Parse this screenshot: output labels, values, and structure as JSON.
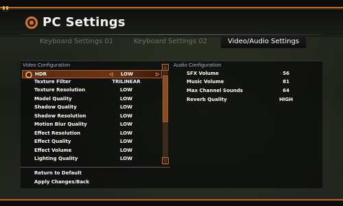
{
  "header": {
    "title": "PC Settings"
  },
  "tabs": [
    {
      "label": "Keyboard Settings 01",
      "active": false
    },
    {
      "label": "Keyboard Settings 02",
      "active": false
    },
    {
      "label": "Video/Audio Settings",
      "active": true
    }
  ],
  "video": {
    "section_label": "Video Configuration",
    "rows": [
      {
        "label": "HDR",
        "value": "LOW"
      },
      {
        "label": "Texture Filter",
        "value": "TRILINEAR"
      },
      {
        "label": "Texture Resolution",
        "value": "LOW"
      },
      {
        "label": "Model Quality",
        "value": "LOW"
      },
      {
        "label": "Shadow Quality",
        "value": "LOW"
      },
      {
        "label": "Shadow Resolution",
        "value": "LOW"
      },
      {
        "label": "Motion Blur Quality",
        "value": "LOW"
      },
      {
        "label": "Effect Resolution",
        "value": "LOW"
      },
      {
        "label": "Effect Quality",
        "value": "LOW"
      },
      {
        "label": "Effect Volume",
        "value": "LOW"
      },
      {
        "label": "Lighting Quality",
        "value": "LOW"
      }
    ],
    "arrow_left": "◁",
    "arrow_right": "▷",
    "scroll_up": "△",
    "scroll_down": "▽"
  },
  "audio": {
    "section_label": "Audio Configuration",
    "rows": [
      {
        "label": "SFX Volume",
        "value": "56"
      },
      {
        "label": "Music Volume",
        "value": "81"
      },
      {
        "label": "Max Channel Sounds",
        "value": "64"
      },
      {
        "label": "Reverb Quality",
        "value": "HIGH"
      }
    ]
  },
  "footer": {
    "return_default": "Return to Default",
    "apply": "Apply Changes/Back"
  },
  "colors": {
    "accent": "#c9651a",
    "selected_row": "#6b3316",
    "section_label": "#aab4d8"
  },
  "icons": {
    "title": "gear-icon",
    "hdr_row": "settings-ring-icon"
  }
}
